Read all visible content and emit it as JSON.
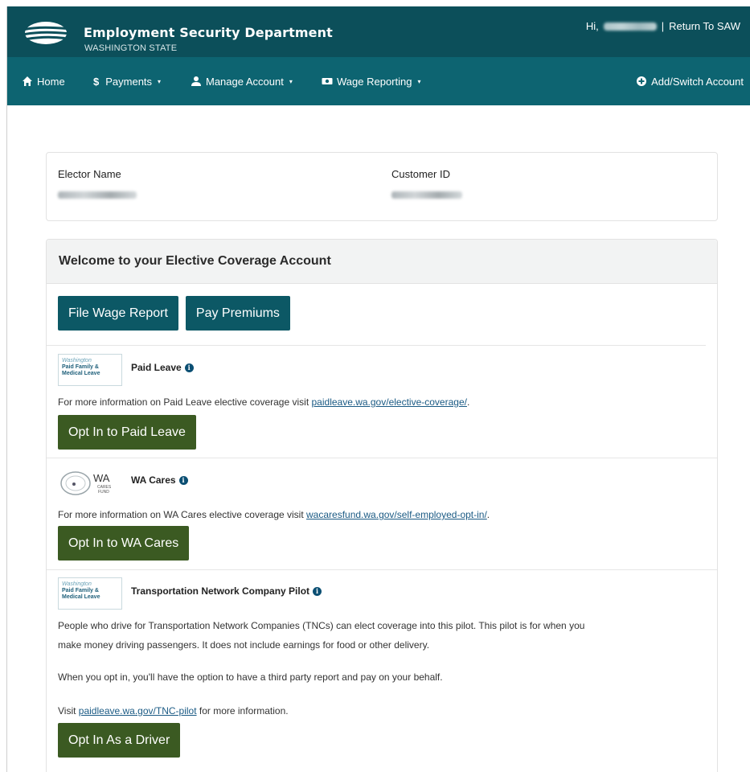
{
  "header": {
    "org_name": "Employment Security Department",
    "org_sub": "WASHINGTON STATE",
    "greeting": "Hi,",
    "separator": "|",
    "return_link": "Return To SAW"
  },
  "nav": {
    "home": "Home",
    "payments": "Payments",
    "manage_account": "Manage Account",
    "wage_reporting": "Wage Reporting",
    "add_switch": "Add/Switch Account"
  },
  "account": {
    "elector_name_label": "Elector Name",
    "customer_id_label": "Customer ID"
  },
  "welcome": {
    "title": "Welcome to your Elective Coverage Account",
    "file_wage_report": "File Wage Report",
    "pay_premiums": "Pay Premiums"
  },
  "paid_leave": {
    "logo_line1": "Washington",
    "logo_line2": "Paid Family &",
    "logo_line3": "Medical Leave",
    "title": "Paid Leave",
    "text_prefix": "For more information on Paid Leave elective coverage visit ",
    "link": "paidleave.wa.gov/elective-coverage/",
    "text_suffix": ".",
    "button": "Opt In to Paid Leave"
  },
  "wa_cares": {
    "logo_wa": "WA",
    "logo_cares": "CARES",
    "logo_fund": "FUND",
    "title": "WA Cares",
    "text_prefix": "For more information on WA Cares elective coverage visit ",
    "link": "wacaresfund.wa.gov/self-employed-opt-in/",
    "text_suffix": ".",
    "button": "Opt In to WA Cares"
  },
  "tnc": {
    "logo_line1": "Washington",
    "logo_line2": "Paid Family &",
    "logo_line3": "Medical Leave",
    "title": "Transportation Network Company Pilot",
    "para1_line1": "People who drive for Transportation Network Companies (TNCs) can elect coverage into this pilot. This pilot is for when you",
    "para1_line2": "make money driving passengers. It does not include earnings for food or other delivery.",
    "para2": "When you opt in, you'll have the option to have a third party report and pay on your behalf.",
    "visit_prefix": "Visit ",
    "link": "paidleave.wa.gov/TNC-pilot",
    "visit_suffix": " for more information.",
    "button": "Opt In As a Driver"
  },
  "icons": {
    "home": "home-icon",
    "payments": "dollar-icon",
    "manage": "user-icon",
    "wage": "money-icon",
    "add": "plus-circle-icon",
    "info": "info-icon"
  },
  "colors": {
    "header_bg": "#0c4f5a",
    "nav_bg": "#0d6471",
    "teal_button": "#0c5865",
    "green_button": "#3b5a22",
    "link": "#1a5a84"
  }
}
